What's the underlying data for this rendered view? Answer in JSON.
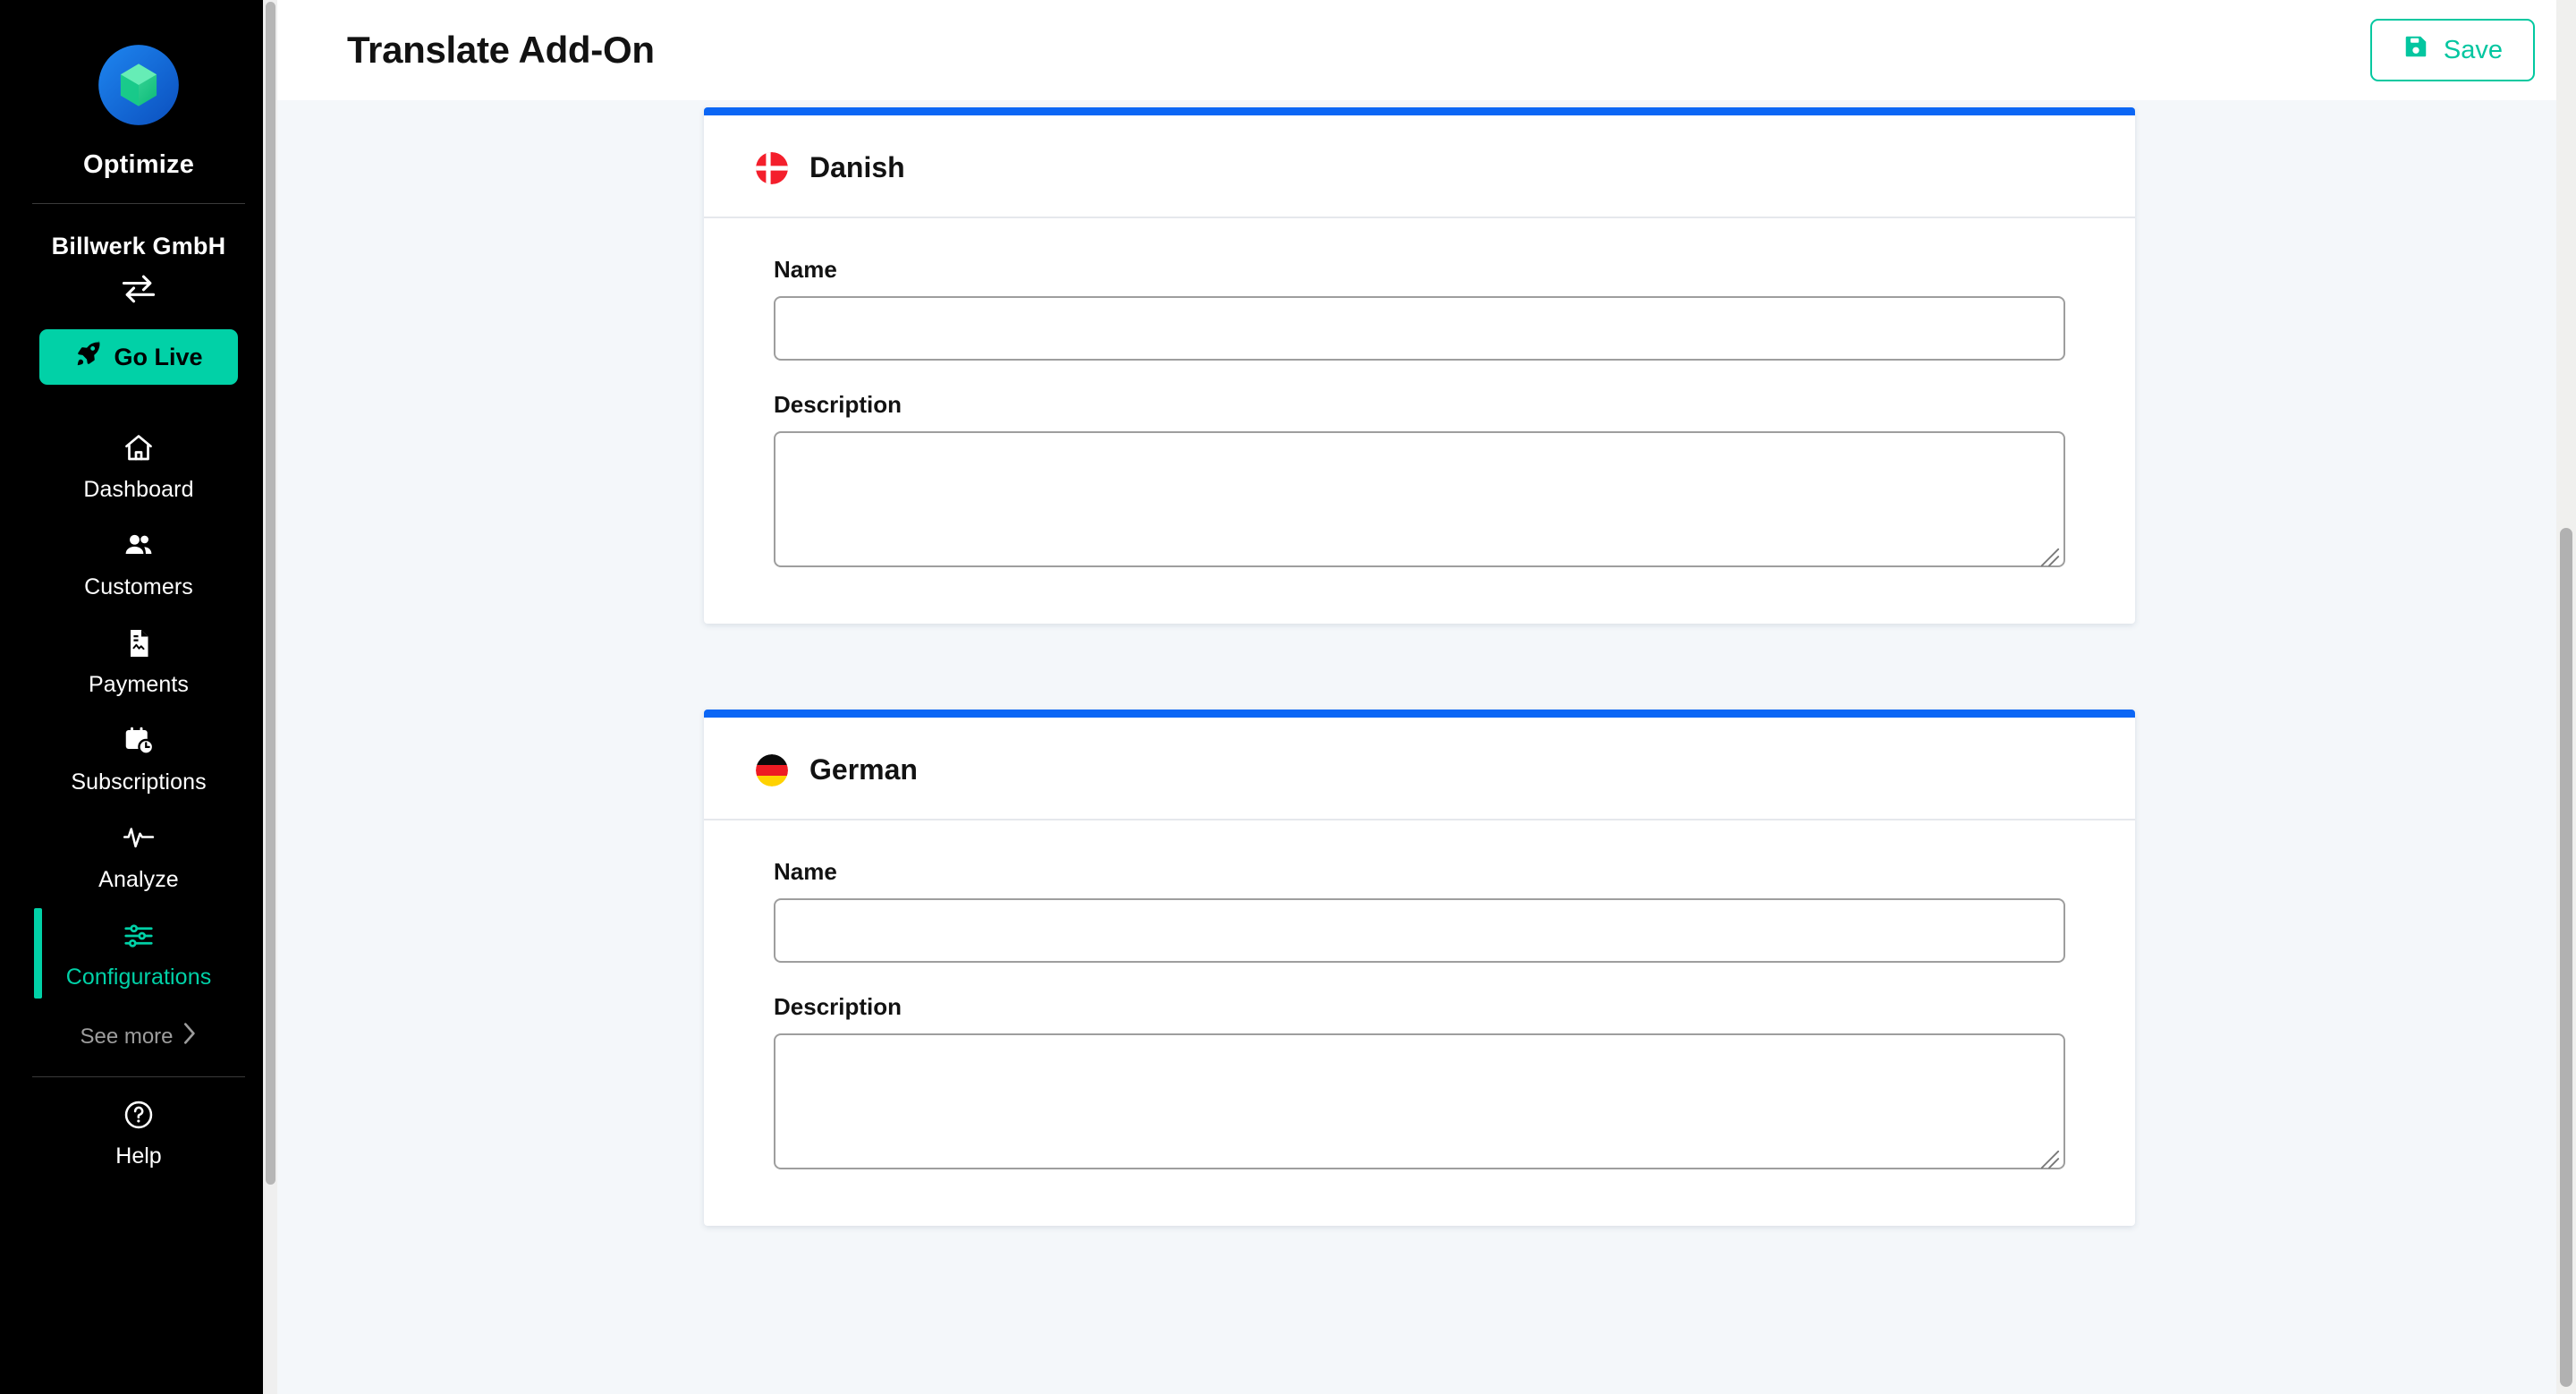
{
  "sidebar": {
    "product_name": "Optimize",
    "logo_icon": "optimize-logo",
    "org_name": "Billwerk GmbH",
    "switch_org_icon": "swap-arrows-icon",
    "go_live_label": "Go Live",
    "go_live_icon": "rocket-icon",
    "nav_items": [
      {
        "label": "Dashboard",
        "icon": "home-icon",
        "active": false
      },
      {
        "label": "Customers",
        "icon": "users-icon",
        "active": false
      },
      {
        "label": "Payments",
        "icon": "document-icon",
        "active": false
      },
      {
        "label": "Subscriptions",
        "icon": "calendar-clock-icon",
        "active": false
      },
      {
        "label": "Analyze",
        "icon": "pulse-icon",
        "active": false
      },
      {
        "label": "Configurations",
        "icon": "sliders-icon",
        "active": true
      }
    ],
    "see_more_label": "See more",
    "see_more_icon": "chevron-right-icon",
    "help_label": "Help",
    "help_icon": "question-circle-icon"
  },
  "header": {
    "title": "Translate Add-On",
    "save_label": "Save",
    "save_icon": "floppy-disk-icon"
  },
  "cards": [
    {
      "language": "Danish",
      "flag_icon": "flag-denmark-icon",
      "name_label": "Name",
      "name_value": "",
      "name_placeholder": "",
      "description_label": "Description",
      "description_value": "",
      "description_placeholder": ""
    },
    {
      "language": "German",
      "flag_icon": "flag-germany-icon",
      "name_label": "Name",
      "name_value": "",
      "name_placeholder": "",
      "description_label": "Description",
      "description_value": "",
      "description_placeholder": ""
    }
  ],
  "colors": {
    "accent_teal": "#01d1a7",
    "card_top_blue": "#0b66f5",
    "sidebar_bg": "#000000",
    "page_bg": "#f4f7fa"
  }
}
